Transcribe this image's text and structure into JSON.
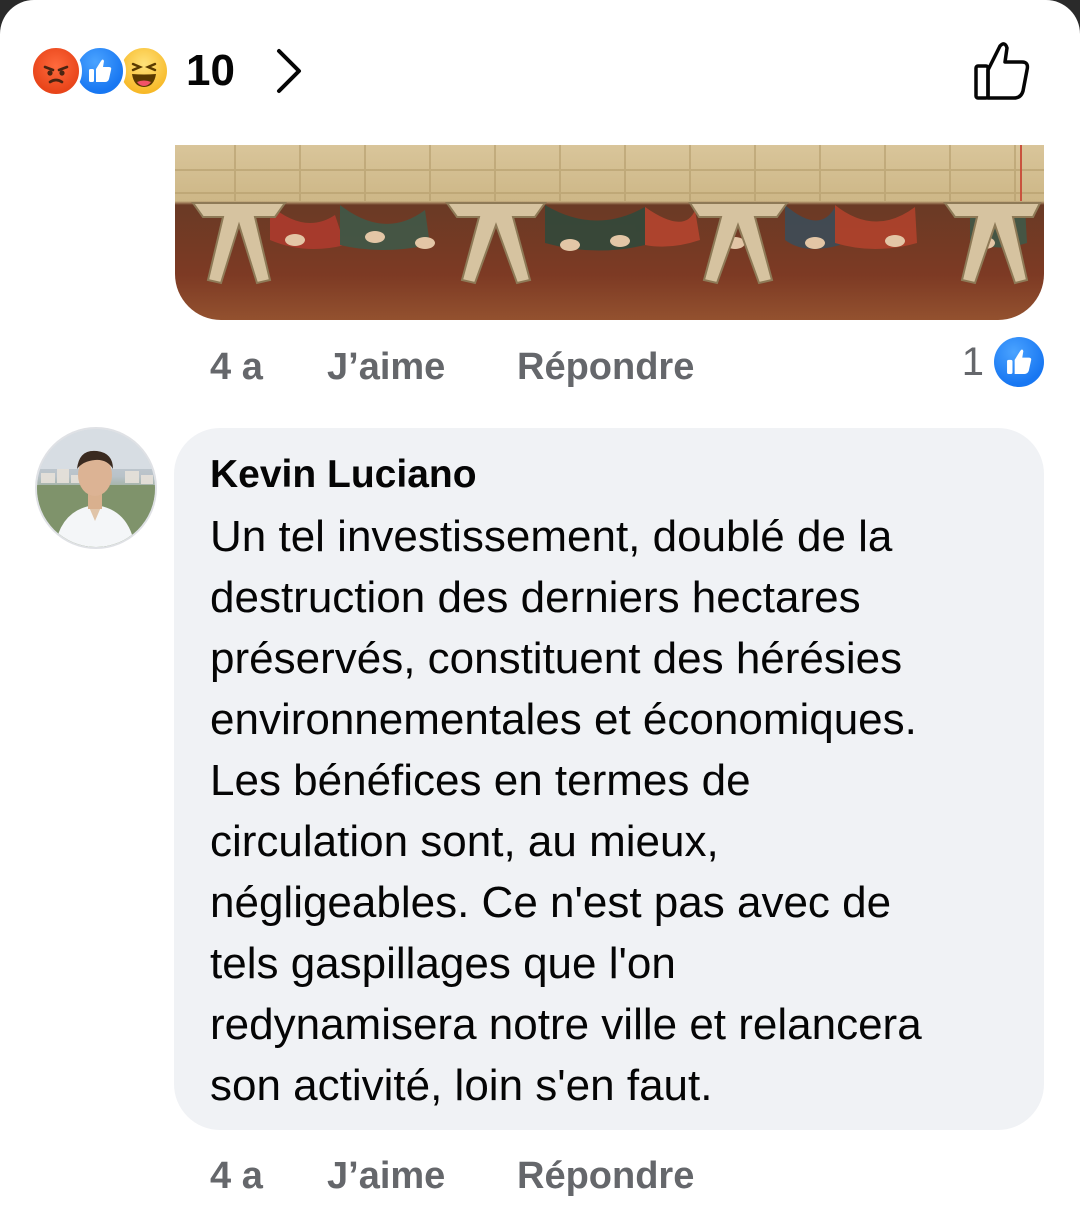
{
  "reactions_bar": {
    "icons": [
      "angry-icon",
      "like-icon",
      "haha-icon"
    ],
    "count": "10"
  },
  "first_comment": {
    "time": "4 a",
    "like_label": "J’aime",
    "reply_label": "Répondre",
    "reaction_count": "1"
  },
  "comment": {
    "author": "Kevin Luciano",
    "text": "Un tel investissement, doublé de la\ndestruction des derniers hectares\npréservés, constituent des hérésies\nenvironnementales et économiques.\nLes bénéfices en termes de\ncirculation sont, au mieux,\nnégligeables. Ce n'est pas avec de\ntels gaspillages que l'on\nredynamisera notre ville et relancera\nson activité, loin s'en faut.",
    "time": "4 a",
    "like_label": "J’aime",
    "reply_label": "Répondre"
  },
  "colors": {
    "like_blue": "#1877f2",
    "secondary_text": "#65676b",
    "bubble_bg": "#f0f2f5"
  }
}
